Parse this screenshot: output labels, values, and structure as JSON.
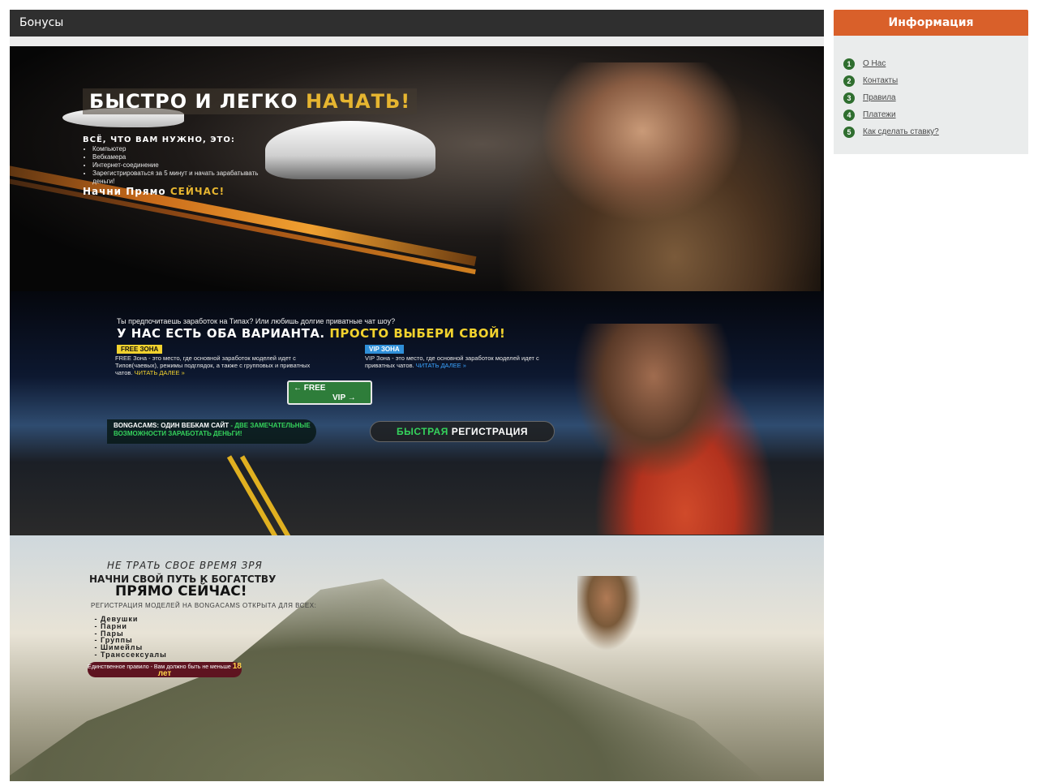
{
  "main": {
    "title": "Бонусы"
  },
  "banners": [
    {
      "title_main": "БЫСТРО И ЛЕГКО",
      "title_accent": "НАЧАТЬ!",
      "subtitle": "ВСЁ, ЧТО ВАМ НУЖНО, ЭТО:",
      "list": [
        "Компьютер",
        "Вебкамера",
        "Интернет-соединение",
        "Зарегистрироваться за 5 минут и начать зарабатывать деньги!"
      ],
      "cta_main": "Начни Прямо",
      "cta_accent": "СЕЙЧАС!"
    },
    {
      "question": "Ты предпочитаешь заработок на Типах? Или любишь долгие приватные чат шоу?",
      "title_main": "У НАС ЕСТЬ ОБА ВАРИАНТА.",
      "title_accent": "ПРОСТО ВЫБЕРИ СВОЙ!",
      "free_tag": "FREE ЗОНА",
      "free_text": "FREE Зона - это место, где основной заработок моделей идет с Типов(чаевых), режимы подглядок, а также с групповых и приватных чатов.",
      "free_link": "ЧИТАТЬ ДАЛЕЕ »",
      "vip_tag": "VIP ЗОНА",
      "vip_text": "VIP Зона - это место, где основной заработок моделей идет с приватных чатов.",
      "vip_link": "ЧИТАТЬ ДАЛЕЕ »",
      "sign_free": "← FREE",
      "sign_vip": "VIP →",
      "pill_main": "BONGACAMS: ОДИН ВЕБКАМ САЙТ",
      "pill_accent": "- ДВЕ ЗАМЕЧАТЕЛЬНЫЕ ВОЗМОЖНОСТИ ЗАРАБОТАТЬ ДЕНЬГИ!",
      "reg_accent": "БЫСТРАЯ",
      "reg_main": "РЕГИСТРАЦИЯ"
    },
    {
      "line1": "НЕ ТРАТЬ СВОЕ ВРЕМЯ ЗРЯ",
      "line2": "НАЧНИ СВОЙ ПУТЬ К БОГАТСТВУ",
      "line3": "ПРЯМО СЕЙЧАС!",
      "reg_text": "РЕГИСТРАЦИЯ МОДЕЛЕЙ НА BONGACAMS ОТКРЫТА ДЛЯ ВСЕХ:",
      "list": [
        "Девушки",
        "Парни",
        "Пары",
        "Группы",
        "Шимейлы",
        "Транссексуалы"
      ],
      "rule_text": "Единственное правило - Вам должно быть не меньше",
      "rule_age": "18 лет"
    }
  ],
  "sidebar": {
    "title": "Информация",
    "items": [
      {
        "num": "1",
        "label": "О Нас"
      },
      {
        "num": "2",
        "label": "Контакты"
      },
      {
        "num": "3",
        "label": "Правила"
      },
      {
        "num": "4",
        "label": "Платежи"
      },
      {
        "num": "5",
        "label": "Как сделать ставку?"
      }
    ]
  },
  "colors": {
    "header_bg": "#2f2f2f",
    "sidebar_accent": "#d9602a",
    "number_badge": "#2f6e2f"
  }
}
